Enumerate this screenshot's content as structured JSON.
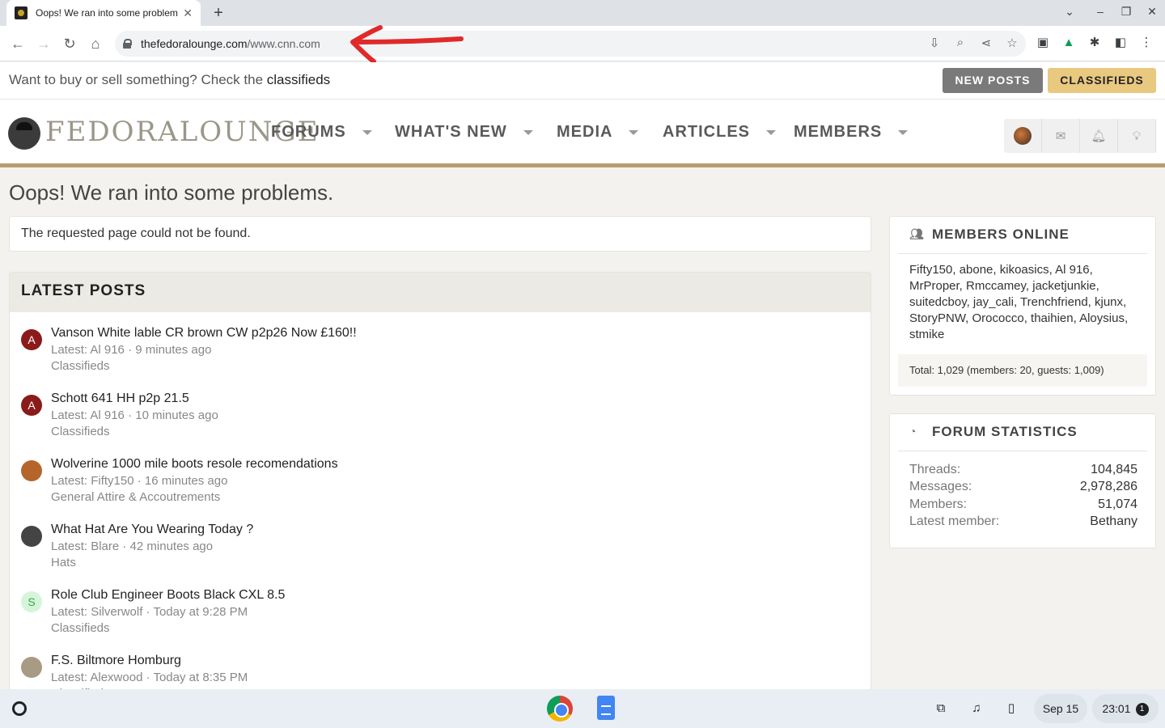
{
  "browser": {
    "tab_title": "Oops! We ran into some problem",
    "url_host": "thefedoralounge.com",
    "url_path": "/www.cnn.com"
  },
  "notice": {
    "text": "Want to buy or sell something? Check the ",
    "link": "classifieds",
    "new_posts_label": "NEW POSTS",
    "classifieds_label": "CLASSIFIEDS"
  },
  "header": {
    "logo_text": "FEDORALOUNGE",
    "nav": [
      "FORUMS",
      "WHAT'S NEW",
      "MEDIA",
      "ARTICLES",
      "MEMBERS"
    ]
  },
  "main": {
    "page_title": "Oops! We ran into some problems.",
    "error_message": "The requested page could not be found.",
    "latest_posts_title": "LATEST POSTS",
    "posts": [
      {
        "avatar_letter": "A",
        "avatar_color": "#8b1a1a",
        "title": "Vanson White lable CR brown CW p2p26 Now £160!!",
        "meta": "Latest: Al 916 · 9 minutes ago",
        "forum": "Classifieds"
      },
      {
        "avatar_letter": "A",
        "avatar_color": "#8b1a1a",
        "title": "Schott 641 HH p2p 21.5",
        "meta": "Latest: Al 916 · 10 minutes ago",
        "forum": "Classifieds"
      },
      {
        "avatar_letter": "",
        "avatar_color": "#b5652b",
        "title": "Wolverine 1000 mile boots resole recomendations",
        "meta": "Latest: Fifty150 · 16 minutes ago",
        "forum": "General Attire & Accoutrements"
      },
      {
        "avatar_letter": "",
        "avatar_color": "#444444",
        "title": "What Hat Are You Wearing Today ?",
        "meta": "Latest: Blare · 42 minutes ago",
        "forum": "Hats"
      },
      {
        "avatar_letter": "S",
        "avatar_color": "#d5f5d9",
        "title": "Role Club Engineer Boots Black CXL 8.5",
        "meta": "Latest: Silverwolf · Today at 9:28 PM",
        "forum": "Classifieds"
      },
      {
        "avatar_letter": "",
        "avatar_color": "#a89b84",
        "title": "F.S. Biltmore Homburg",
        "meta": "Latest: Alexwood · Today at 8:35 PM",
        "forum": "Classifieds"
      }
    ]
  },
  "sidebar": {
    "members_online_title": "MEMBERS ONLINE",
    "members_online": "Fifty150, abone, kikoasics, Al 916, MrProper, Rmccamey, jacketjunkie, suitedcboy, jay_cali, Trenchfriend, kjunx, StoryPNW, Orococco, thaihien, Aloysius, stmike",
    "members_total": "Total: 1,029 (members: 20, guests: 1,009)",
    "forum_stats_title": "FORUM STATISTICS",
    "stats": [
      {
        "label": "Threads:",
        "value": "104,845"
      },
      {
        "label": "Messages:",
        "value": "2,978,286"
      },
      {
        "label": "Members:",
        "value": "51,074"
      },
      {
        "label": "Latest member:",
        "value": "Bethany"
      }
    ]
  },
  "shelf": {
    "date": "Sep 15",
    "time": "23:01",
    "notification_count": "1"
  }
}
